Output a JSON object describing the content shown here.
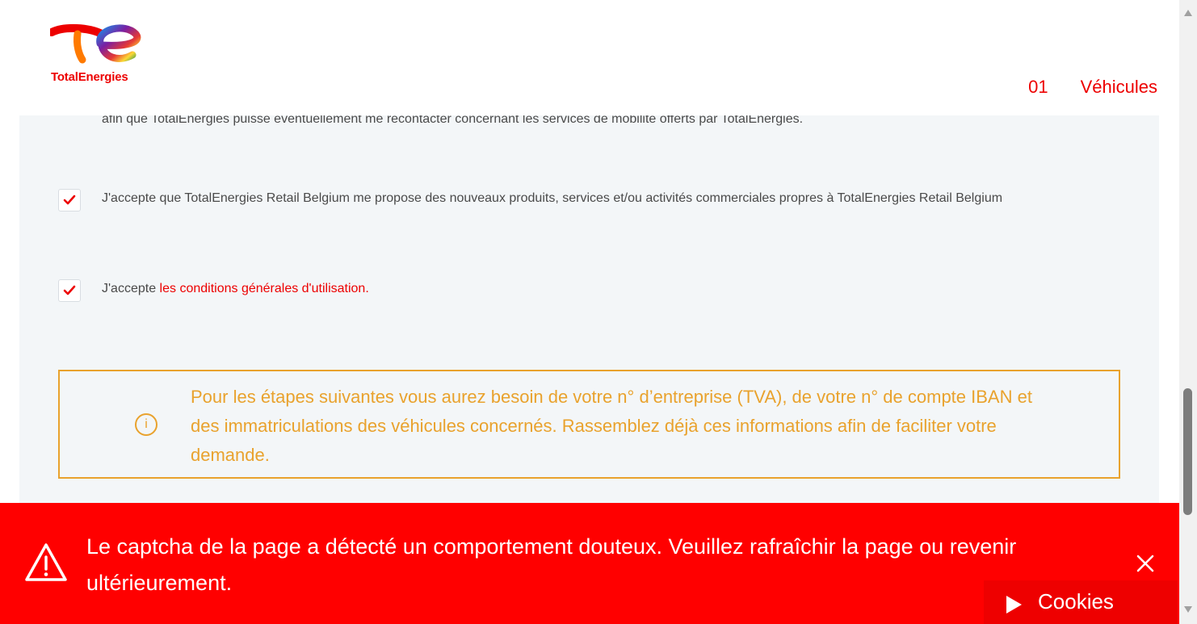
{
  "header": {
    "logo_text": "TotalEnergies",
    "step_number": "01",
    "step_label": "Véhicules"
  },
  "content": {
    "cut_text": "afin que TotalEnergies puisse éventuellement me recontacter concernant les services de mobilité offerts par TotalEnergies.",
    "consent_marketing": {
      "label": "J'accepte que TotalEnergies Retail Belgium me propose des nouveaux produits, services et/ou activités commerciales propres à TotalEnergies Retail Belgium",
      "checked": true
    },
    "consent_terms": {
      "prefix": "J'accepte ",
      "link": "les conditions générales d'utilisation",
      "suffix": ".",
      "checked": true
    },
    "info": {
      "icon": "i",
      "text": "Pour les étapes suivantes vous aurez besoin de votre n° d’entreprise (TVA), de votre n° de compte IBAN et des immatriculations des véhicules concernés. Rassemblez déjà ces informations afin de faciliter votre demande."
    }
  },
  "alert": {
    "message": "Le captcha de la page a détecté un comportement douteux. Veuillez rafraîchir la page ou revenir ultérieurement."
  },
  "cookies": {
    "label": "Cookies"
  },
  "colors": {
    "brand_red": "#ed0000",
    "info_orange": "#e9a22d",
    "alert_red": "#ff0000",
    "content_bg": "#f3f6f8"
  }
}
